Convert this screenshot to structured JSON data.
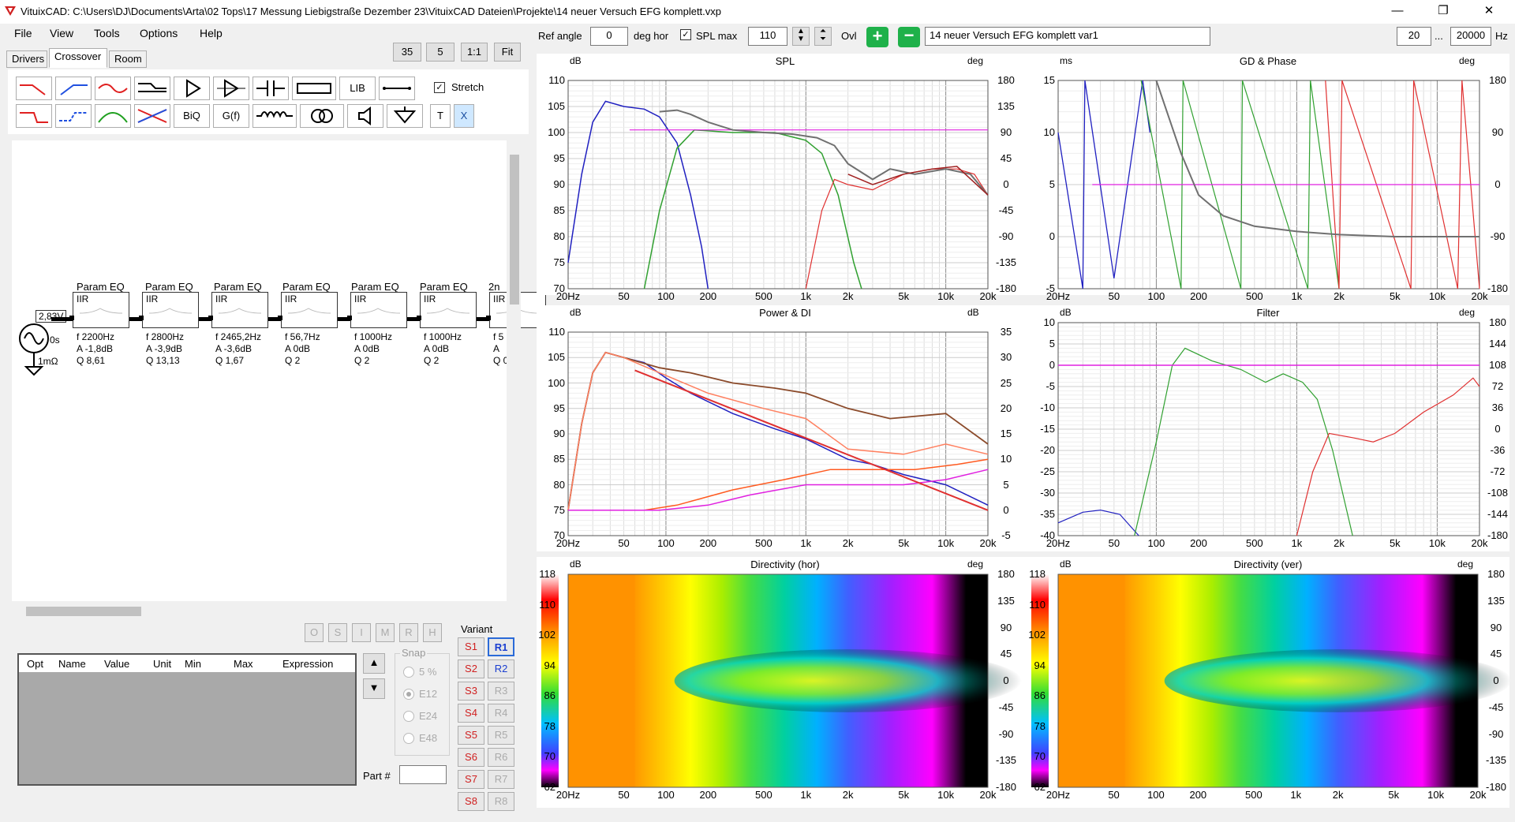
{
  "window": {
    "title": "VituixCAD: C:\\Users\\DJ\\Documents\\Arta\\02 Tops\\17 Messung Liebigstraße Dezember 23\\VituixCAD Dateien\\Projekte\\14 neuer Versuch EFG komplett.vxp",
    "min": "—",
    "max": "❐",
    "close": "✕"
  },
  "menu": [
    "File",
    "View",
    "Tools",
    "Options",
    "Help"
  ],
  "tabs": [
    "Drivers",
    "Crossover",
    "Room"
  ],
  "toolbar_right": {
    "v1": "35",
    "v2": "5",
    "ratio": "1:1",
    "fit": "Fit"
  },
  "tools": {
    "lib": "LIB",
    "biq": "BiQ",
    "gf": "G(f)",
    "t": "T",
    "x": "X",
    "stretch": "Stretch"
  },
  "source": {
    "voltage": "2,83V",
    "delay": "0s",
    "impedance": "1mΩ"
  },
  "eq_blocks": [
    {
      "title": "Param EQ",
      "type": "IIR",
      "f": "f   2200Hz",
      "a": "A  -1,8dB",
      "q": "Q  8,61"
    },
    {
      "title": "Param EQ",
      "type": "IIR",
      "f": "f   2800Hz",
      "a": "A  -3,9dB",
      "q": "Q  13,13"
    },
    {
      "title": "Param EQ",
      "type": "IIR",
      "f": "f   2465,2Hz",
      "a": "A  -3,6dB",
      "q": "Q  1,67"
    },
    {
      "title": "Param EQ",
      "type": "IIR",
      "f": "f   56,7Hz",
      "a": "A  0dB",
      "q": "Q  2"
    },
    {
      "title": "Param EQ",
      "type": "IIR",
      "f": "f   1000Hz",
      "a": "A  0dB",
      "q": "Q  2"
    },
    {
      "title": "Param EQ",
      "type": "IIR",
      "f": "f   1000Hz",
      "a": "A  0dB",
      "q": "Q  2"
    },
    {
      "title": "2n",
      "type": "IIR",
      "f": "f  5",
      "a": "A  ",
      "q": "Q  0"
    }
  ],
  "opt_buttons": [
    "O",
    "S",
    "I",
    "M",
    "R",
    "H"
  ],
  "table_headers": [
    "Opt",
    "Name",
    "Value",
    "Unit",
    "Min",
    "Max",
    "Expression"
  ],
  "snap": {
    "label": "Snap",
    "options": [
      "5 %",
      "E12",
      "E24",
      "E48"
    ],
    "selected": "E12"
  },
  "part_label": "Part #",
  "variant": {
    "label": "Variant",
    "s": [
      "S1",
      "S2",
      "S3",
      "S4",
      "S5",
      "S6",
      "S7",
      "S8"
    ],
    "r": [
      "R1",
      "R2",
      "R3",
      "R4",
      "R5",
      "R6",
      "R7",
      "R8"
    ]
  },
  "topbar": {
    "ref_angle_label": "Ref angle",
    "ref_angle_value": "0",
    "deg_hor": "deg hor",
    "spl_max_label": "SPL max",
    "spl_max_value": "110",
    "ovl": "Ovl",
    "variant_name": "14 neuer Versuch EFG komplett var1",
    "f_min": "20",
    "ellipsis": "...",
    "f_max": "20000",
    "hz": "Hz"
  },
  "colors": {
    "blue": "#2020c0",
    "green": "#30a030",
    "red": "#e03030",
    "gray": "#707070",
    "darkred": "#a02020",
    "magenta": "#e020e0",
    "brown": "#8b4a2a",
    "orange": "#ff5a20",
    "salmon": "#ff8060"
  },
  "charts": {
    "spl": {
      "title": "SPL",
      "yunit": "dB",
      "y2unit": "deg",
      "yticks": [
        "110",
        "105",
        "100",
        "95",
        "90",
        "85",
        "80",
        "75",
        "70"
      ],
      "y2ticks": [
        "180",
        "135",
        "90",
        "45",
        "0",
        "-45",
        "-90",
        "-135",
        "-180"
      ]
    },
    "gd": {
      "title": "GD & Phase",
      "yunit": "ms",
      "y2unit": "deg",
      "yticks": [
        "15",
        "10",
        "5",
        "0",
        "-5"
      ],
      "y2ticks": [
        "180",
        "90",
        "0",
        "-90",
        "-180"
      ]
    },
    "power": {
      "title": "Power & DI",
      "yunit": "dB",
      "y2unit": "dB",
      "yticks": [
        "110",
        "105",
        "100",
        "95",
        "90",
        "85",
        "80",
        "75",
        "70"
      ],
      "y2ticks": [
        "35",
        "30",
        "25",
        "20",
        "15",
        "10",
        "5",
        "0",
        "-5"
      ]
    },
    "filter": {
      "title": "Filter",
      "yunit": "dB",
      "y2unit": "deg",
      "yticks": [
        "10",
        "5",
        "0",
        "-5",
        "-10",
        "-15",
        "-20",
        "-25",
        "-30",
        "-35",
        "-40"
      ],
      "y2ticks": [
        "180",
        "144",
        "108",
        "72",
        "36",
        "0",
        "-36",
        "-72",
        "-108",
        "-144",
        "-180"
      ]
    },
    "dirhor": {
      "title": "Directivity (hor)",
      "yunit": "dB",
      "y2unit": "deg",
      "scale": [
        "118",
        "110",
        "102",
        "94",
        "86",
        "78",
        "70",
        "62"
      ],
      "y2ticks": [
        "180",
        "135",
        "90",
        "45",
        "0",
        "-45",
        "-90",
        "-135",
        "-180"
      ]
    },
    "dirver": {
      "title": "Directivity (ver)",
      "yunit": "dB",
      "y2unit": "deg",
      "scale": [
        "118",
        "110",
        "102",
        "94",
        "86",
        "78",
        "70",
        "62"
      ],
      "y2ticks": [
        "180",
        "135",
        "90",
        "45",
        "0",
        "-45",
        "-90",
        "-135",
        "-180"
      ]
    },
    "xticks": [
      "20Hz",
      "50",
      "100",
      "200",
      "500",
      "1k",
      "2k",
      "5k",
      "10k",
      "20k"
    ]
  }
}
